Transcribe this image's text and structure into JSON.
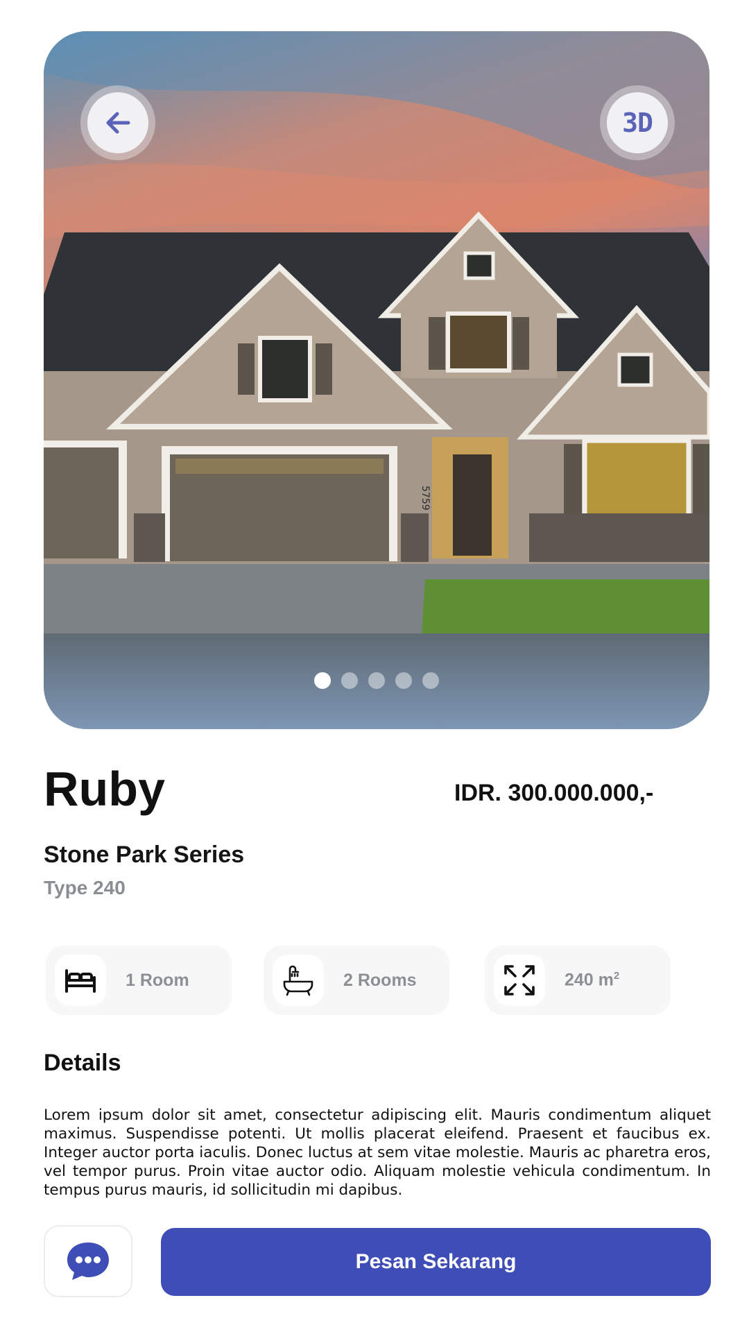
{
  "hero": {
    "three_d_label": "3D",
    "slides": 5,
    "active_slide": 1,
    "house_number": "5759"
  },
  "property": {
    "name": "Ruby",
    "price": "IDR. 300.000.000,-",
    "series": "Stone Park Series",
    "type": "Type 240"
  },
  "features": [
    {
      "icon": "bed-icon",
      "label": "1 Room"
    },
    {
      "icon": "bathtub-icon",
      "label": "2 Rooms"
    },
    {
      "icon": "expand-icon",
      "label": "240 m",
      "superscript": "2"
    }
  ],
  "details": {
    "heading": "Details",
    "text": "Lorem ipsum dolor sit amet, consectetur adipiscing elit. Mauris condimentum aliquet maximus. Suspendisse potenti. Ut mollis placerat eleifend. Praesent et faucibus ex. Integer auctor porta iaculis. Donec luctus at sem vitae molestie. Mauris ac pharetra eros, vel tempor purus. Proin vitae auctor odio. Aliquam molestie vehicula condimentum. In tempus purus mauris, id sollicitudin mi dapibus."
  },
  "actions": {
    "chat_icon": "chat-bubble-icon",
    "order_label": "Pesan Sekarang"
  },
  "colors": {
    "primary": "#3f4db6",
    "accent_icon": "#5b63b8",
    "muted_text": "#8c8f94"
  }
}
